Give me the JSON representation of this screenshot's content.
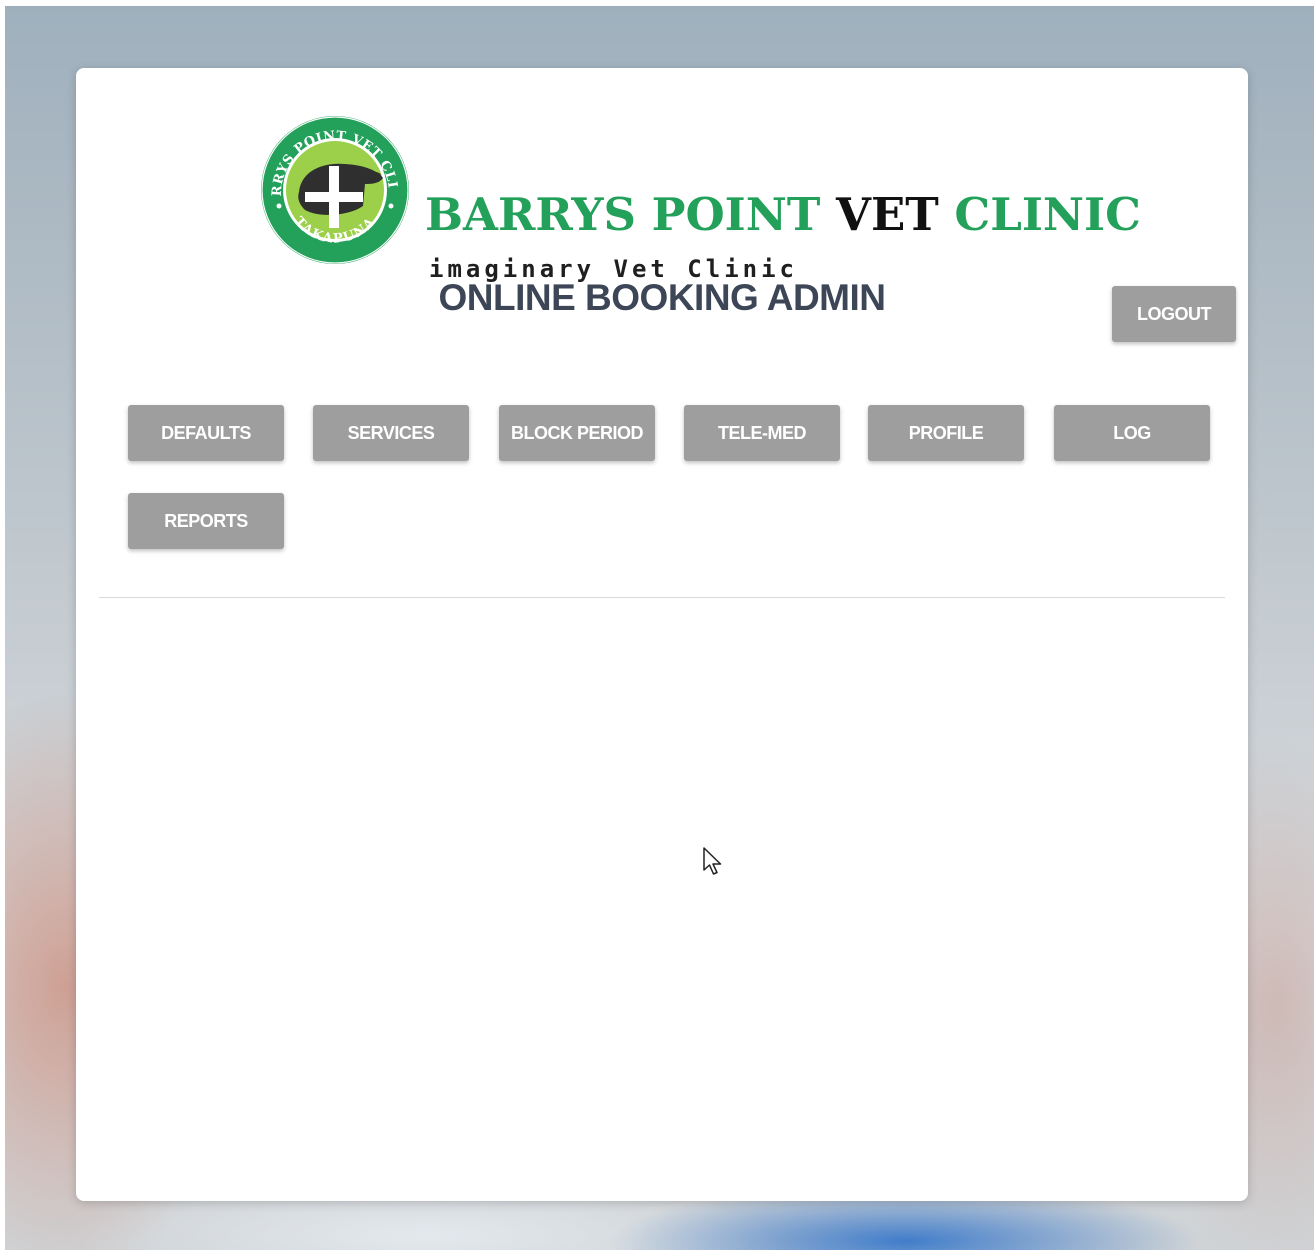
{
  "logo": {
    "seal_top_text": "BARRYS POINT VET CLINIC",
    "seal_bottom_text": "TAKAPUNA",
    "name_part1": "BARRYS POINT",
    "name_part2": "VET",
    "name_part3": "CLINIC",
    "tagline": "imaginary Vet Clinic"
  },
  "header": {
    "title": "ONLINE BOOKING ADMIN",
    "logout_label": "LOGOUT"
  },
  "nav": {
    "buttons": [
      {
        "label": "DEFAULTS"
      },
      {
        "label": "SERVICES"
      },
      {
        "label": "BLOCK PERIOD"
      },
      {
        "label": "TELE-MED"
      },
      {
        "label": "PROFILE"
      },
      {
        "label": "LOG"
      },
      {
        "label": "REPORTS"
      }
    ]
  },
  "colors": {
    "brand_green": "#23a05a",
    "button_gray": "#9e9e9e",
    "title_color": "#3c4656"
  }
}
